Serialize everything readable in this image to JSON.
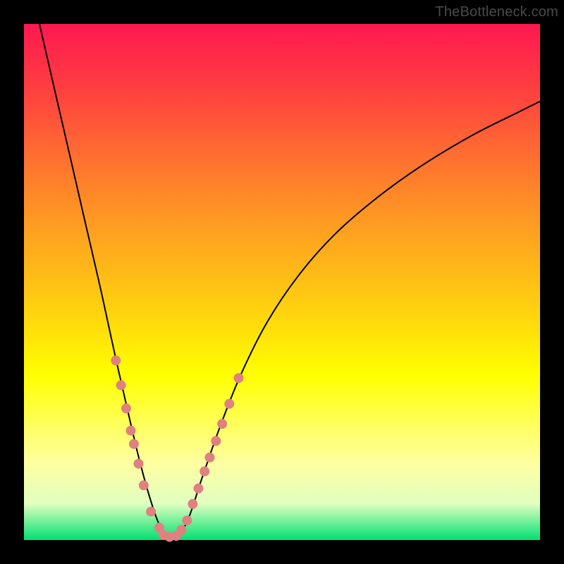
{
  "watermark": "TheBottleneck.com",
  "chart_data": {
    "type": "line",
    "title": "",
    "xlabel": "",
    "ylabel": "",
    "xlim": [
      0,
      1
    ],
    "ylim": [
      0,
      1
    ],
    "notes": "V-shaped bottleneck curve over red-yellow-green gradient. Axes are unlabeled; x and y are normalized 0..1. Minimum (y≈0) near x≈0.28. Pink dots mark sampled curve points near the floor.",
    "background_gradient": [
      {
        "pos": 0.0,
        "color": "#ff1850"
      },
      {
        "pos": 0.13,
        "color": "#ff4040"
      },
      {
        "pos": 0.26,
        "color": "#ff7030"
      },
      {
        "pos": 0.4,
        "color": "#ffa020"
      },
      {
        "pos": 0.55,
        "color": "#ffd010"
      },
      {
        "pos": 0.68,
        "color": "#ffff00"
      },
      {
        "pos": 0.78,
        "color": "#ffff60"
      },
      {
        "pos": 0.85,
        "color": "#ffffa0"
      },
      {
        "pos": 0.93,
        "color": "#e0ffc0"
      },
      {
        "pos": 1.0,
        "color": "#00e070"
      }
    ],
    "series": [
      {
        "name": "bottleneck-curve",
        "x": [
          0.03,
          0.06,
          0.09,
          0.12,
          0.15,
          0.175,
          0.2,
          0.22,
          0.24,
          0.26,
          0.28,
          0.3,
          0.32,
          0.345,
          0.38,
          0.42,
          0.47,
          0.53,
          0.6,
          0.68,
          0.77,
          0.87,
          0.96,
          1.0
        ],
        "y": [
          1.0,
          0.87,
          0.74,
          0.61,
          0.48,
          0.365,
          0.255,
          0.17,
          0.095,
          0.035,
          0.005,
          0.01,
          0.045,
          0.12,
          0.22,
          0.32,
          0.42,
          0.51,
          0.59,
          0.66,
          0.725,
          0.785,
          0.83,
          0.85
        ]
      },
      {
        "name": "sample-dots-left",
        "x": [
          0.178,
          0.188,
          0.198,
          0.207,
          0.213,
          0.222,
          0.232,
          0.246,
          0.262
        ],
        "y": [
          0.348,
          0.3,
          0.255,
          0.212,
          0.186,
          0.148,
          0.106,
          0.055,
          0.024
        ]
      },
      {
        "name": "sample-dots-bottom",
        "x": [
          0.27,
          0.282,
          0.295,
          0.305
        ],
        "y": [
          0.01,
          0.006,
          0.008,
          0.02
        ]
      },
      {
        "name": "sample-dots-right",
        "x": [
          0.316,
          0.327,
          0.338,
          0.35,
          0.36,
          0.372,
          0.384,
          0.398,
          0.416
        ],
        "y": [
          0.038,
          0.07,
          0.1,
          0.133,
          0.16,
          0.192,
          0.225,
          0.264,
          0.314
        ]
      }
    ]
  }
}
